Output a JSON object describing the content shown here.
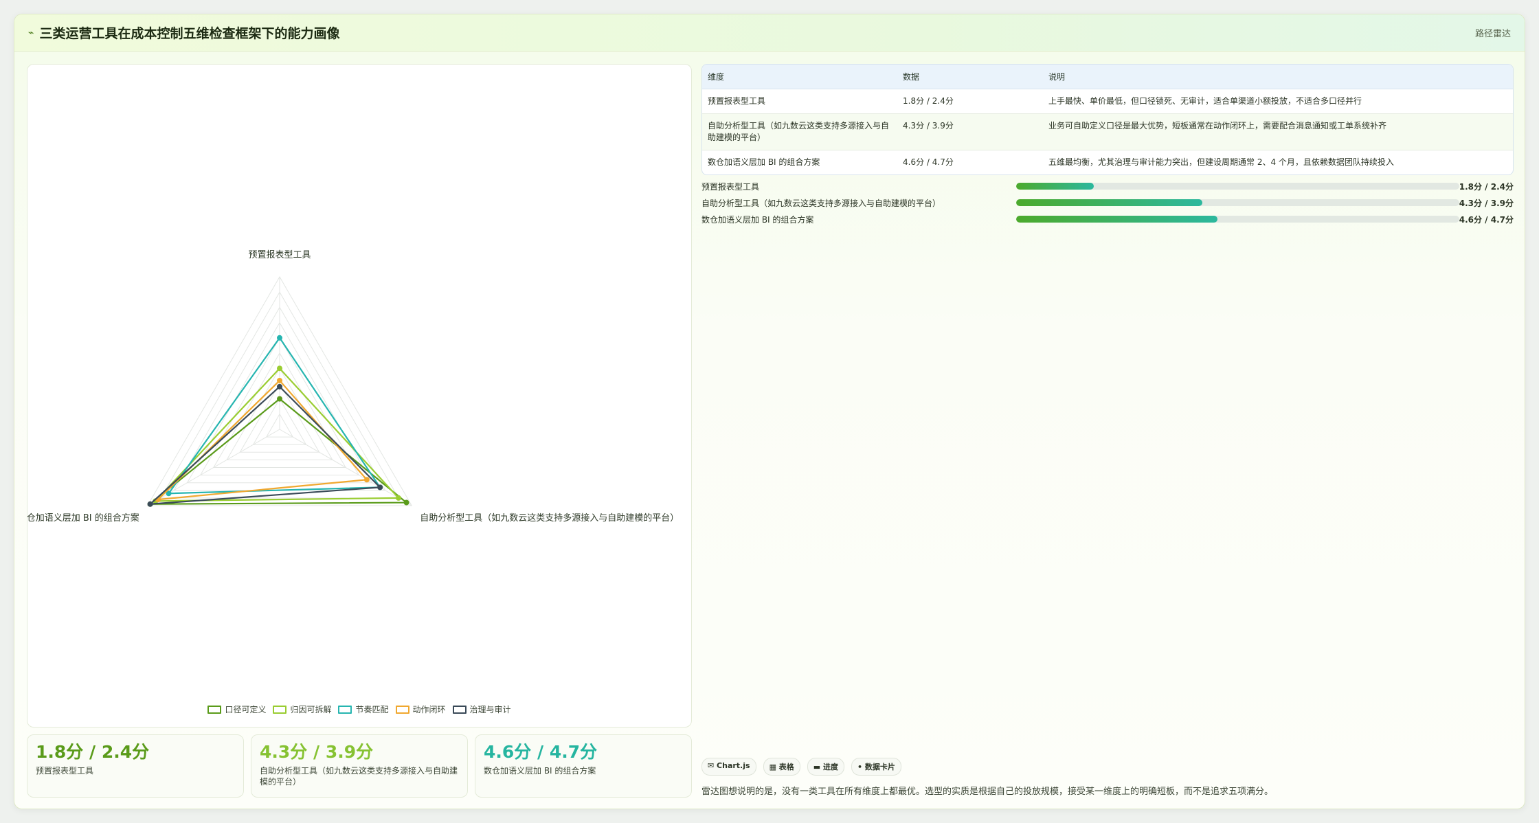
{
  "header": {
    "icon": "chart-icon",
    "title": "三类运营工具在成本控制五维检查框架下的能力画像",
    "route": "路径雷达"
  },
  "colors": {
    "series": [
      "#5a9b1a",
      "#9acd32",
      "#26b5b0",
      "#f0a830",
      "#3a4a58"
    ],
    "stat": [
      "#5a9b1a",
      "#86c232",
      "#26b5a0"
    ]
  },
  "chart_data": {
    "type": "radar",
    "axes": [
      "预置报表型工具",
      "自助分析型工具（如九数云这类支持多源接入与自助建模的平台）",
      "数仓加语义层加 BI 的组合方案"
    ],
    "rmax": 5,
    "series": [
      {
        "name": "口径可定义",
        "values": [
          1.0,
          4.8,
          4.9
        ]
      },
      {
        "name": "归因可拆解",
        "values": [
          2.0,
          4.5,
          4.7
        ]
      },
      {
        "name": "节奏匹配",
        "values": [
          3.0,
          3.8,
          4.2
        ]
      },
      {
        "name": "动作闭环",
        "values": [
          1.6,
          3.3,
          4.6
        ]
      },
      {
        "name": "治理与审计",
        "values": [
          1.4,
          3.8,
          4.9
        ]
      }
    ],
    "legend_position": "bottom"
  },
  "table": {
    "headers": [
      "维度",
      "数据",
      "说明"
    ],
    "rows": [
      [
        "预置报表型工具",
        "1.8分 / 2.4分",
        "上手最快、单价最低，但口径锁死、无审计，适合单渠道小额投放，不适合多口径并行"
      ],
      [
        "自助分析型工具（如九数云这类支持多源接入与自助建模的平台）",
        "4.3分 / 3.9分",
        "业务可自助定义口径是最大优势，短板通常在动作闭环上，需要配合消息通知或工单系统补齐"
      ],
      [
        "数仓加语义层加 BI 的组合方案",
        "4.6分 / 4.7分",
        "五维最均衡，尤其治理与审计能力突出，但建设周期通常 2、4 个月，且依赖数据团队持续投入"
      ]
    ]
  },
  "bars": [
    {
      "label": "预置报表型工具",
      "value": "1.8分 / 2.4分",
      "fraction": 0.175
    },
    {
      "label": "自助分析型工具（如九数云这类支持多源接入与自助建模的平台）",
      "value": "4.3分 / 3.9分",
      "fraction": 0.42
    },
    {
      "label": "数仓加语义层加 BI 的组合方案",
      "value": "4.6分 / 4.7分",
      "fraction": 0.455
    }
  ],
  "stats": [
    {
      "value": "1.8分 / 2.4分",
      "caption": "预置报表型工具"
    },
    {
      "value": "4.3分 / 3.9分",
      "caption": "自助分析型工具（如九数云这类支持多源接入与自助建模的平台）"
    },
    {
      "value": "4.6分 / 4.7分",
      "caption": "数仓加语义层加 BI 的组合方案"
    }
  ],
  "chips": [
    "✉ Chart.js",
    "▦ 表格",
    "▬ 进度",
    "• 数据卡片"
  ],
  "footnote": "雷达图想说明的是，没有一类工具在所有维度上都最优。选型的实质是根据自己的投放规模，接受某一维度上的明确短板，而不是追求五项满分。"
}
